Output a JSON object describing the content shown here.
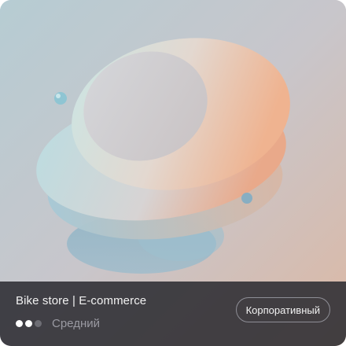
{
  "card": {
    "title": "Bike store | E-commerce",
    "difficulty": {
      "label": "Средний",
      "filled": 2,
      "total": 3
    },
    "tag": "Корпоративный"
  },
  "colors": {
    "bar_bg": "#2c2c32",
    "dot_on": "#ffffff",
    "dot_off": "#6d6d74"
  }
}
